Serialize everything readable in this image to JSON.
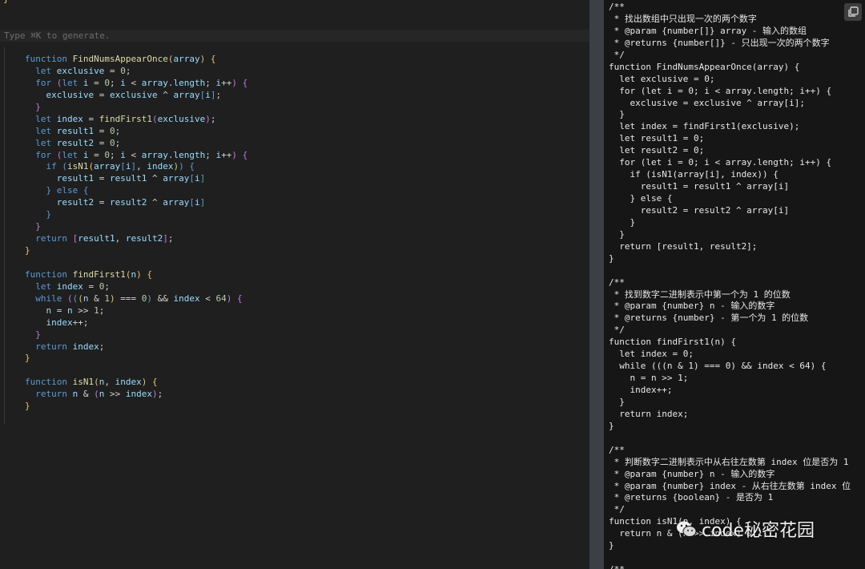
{
  "editor": {
    "stub_char": "}",
    "prompt_placeholder": "Type ⌘K to generate.",
    "code_lines": [
      [
        [
          "kw",
          "function "
        ],
        [
          "fn",
          "FindNumsAppearOnce"
        ],
        [
          "br",
          "("
        ],
        [
          "var",
          "array"
        ],
        [
          "br",
          ") {"
        ]
      ],
      [
        [
          "op",
          "  "
        ],
        [
          "kw",
          "let "
        ],
        [
          "var",
          "exclusive"
        ],
        [
          "op",
          " = "
        ],
        [
          "num",
          "0"
        ],
        [
          "op",
          ";"
        ]
      ],
      [
        [
          "op",
          "  "
        ],
        [
          "kw",
          "for "
        ],
        [
          "br2",
          "("
        ],
        [
          "kw",
          "let "
        ],
        [
          "var",
          "i"
        ],
        [
          "op",
          " = "
        ],
        [
          "num",
          "0"
        ],
        [
          "op",
          "; "
        ],
        [
          "var",
          "i"
        ],
        [
          "op",
          " < "
        ],
        [
          "var",
          "array"
        ],
        [
          "op",
          "."
        ],
        [
          "var",
          "length"
        ],
        [
          "op",
          "; "
        ],
        [
          "var",
          "i"
        ],
        [
          "op",
          "++"
        ],
        [
          "br2",
          ") {"
        ]
      ],
      [
        [
          "op",
          "    "
        ],
        [
          "var",
          "exclusive"
        ],
        [
          "op",
          " = "
        ],
        [
          "var",
          "exclusive"
        ],
        [
          "op",
          " ^ "
        ],
        [
          "var",
          "array"
        ],
        [
          "kw",
          "["
        ],
        [
          "var",
          "i"
        ],
        [
          "kw",
          "]"
        ],
        [
          "op",
          ";"
        ]
      ],
      [
        [
          "op",
          "  "
        ],
        [
          "br2",
          "}"
        ]
      ],
      [
        [
          "op",
          "  "
        ],
        [
          "kw",
          "let "
        ],
        [
          "var",
          "index"
        ],
        [
          "op",
          " = "
        ],
        [
          "fn",
          "findFirst1"
        ],
        [
          "br2",
          "("
        ],
        [
          "var",
          "exclusive"
        ],
        [
          "br2",
          ")"
        ],
        [
          "op",
          ";"
        ]
      ],
      [
        [
          "op",
          "  "
        ],
        [
          "kw",
          "let "
        ],
        [
          "var",
          "result1"
        ],
        [
          "op",
          " = "
        ],
        [
          "num",
          "0"
        ],
        [
          "op",
          ";"
        ]
      ],
      [
        [
          "op",
          "  "
        ],
        [
          "kw",
          "let "
        ],
        [
          "var",
          "result2"
        ],
        [
          "op",
          " = "
        ],
        [
          "num",
          "0"
        ],
        [
          "op",
          ";"
        ]
      ],
      [
        [
          "op",
          "  "
        ],
        [
          "kw",
          "for "
        ],
        [
          "br2",
          "("
        ],
        [
          "kw",
          "let "
        ],
        [
          "var",
          "i"
        ],
        [
          "op",
          " = "
        ],
        [
          "num",
          "0"
        ],
        [
          "op",
          "; "
        ],
        [
          "var",
          "i"
        ],
        [
          "op",
          " < "
        ],
        [
          "var",
          "array"
        ],
        [
          "op",
          "."
        ],
        [
          "var",
          "length"
        ],
        [
          "op",
          "; "
        ],
        [
          "var",
          "i"
        ],
        [
          "op",
          "++"
        ],
        [
          "br2",
          ") {"
        ]
      ],
      [
        [
          "op",
          "    "
        ],
        [
          "kw",
          "if "
        ],
        [
          "kw",
          "("
        ],
        [
          "fn",
          "isN1"
        ],
        [
          "br",
          "("
        ],
        [
          "var",
          "array"
        ],
        [
          "kw",
          "["
        ],
        [
          "var",
          "i"
        ],
        [
          "kw",
          "]"
        ],
        [
          "op",
          ", "
        ],
        [
          "var",
          "index"
        ],
        [
          "br",
          ")"
        ],
        [
          "kw",
          ") {"
        ]
      ],
      [
        [
          "op",
          "      "
        ],
        [
          "var",
          "result1"
        ],
        [
          "op",
          " = "
        ],
        [
          "var",
          "result1"
        ],
        [
          "op",
          " ^ "
        ],
        [
          "var",
          "array"
        ],
        [
          "kw",
          "["
        ],
        [
          "var",
          "i"
        ],
        [
          "kw",
          "]"
        ]
      ],
      [
        [
          "op",
          "    "
        ],
        [
          "kw",
          "} "
        ],
        [
          "kw",
          "else "
        ],
        [
          "kw",
          "{"
        ]
      ],
      [
        [
          "op",
          "      "
        ],
        [
          "var",
          "result2"
        ],
        [
          "op",
          " = "
        ],
        [
          "var",
          "result2"
        ],
        [
          "op",
          " ^ "
        ],
        [
          "var",
          "array"
        ],
        [
          "kw",
          "["
        ],
        [
          "var",
          "i"
        ],
        [
          "kw",
          "]"
        ]
      ],
      [
        [
          "op",
          "    "
        ],
        [
          "kw",
          "}"
        ]
      ],
      [
        [
          "op",
          "  "
        ],
        [
          "br2",
          "}"
        ]
      ],
      [
        [
          "op",
          "  "
        ],
        [
          "kw",
          "return "
        ],
        [
          "br2",
          "["
        ],
        [
          "var",
          "result1"
        ],
        [
          "op",
          ", "
        ],
        [
          "var",
          "result2"
        ],
        [
          "br2",
          "]"
        ],
        [
          "op",
          ";"
        ]
      ],
      [
        [
          "br",
          "}"
        ]
      ],
      [
        [
          "op",
          ""
        ]
      ],
      [
        [
          "kw",
          "function "
        ],
        [
          "fn",
          "findFirst1"
        ],
        [
          "br",
          "("
        ],
        [
          "var",
          "n"
        ],
        [
          "br",
          ") {"
        ]
      ],
      [
        [
          "op",
          "  "
        ],
        [
          "kw",
          "let "
        ],
        [
          "var",
          "index"
        ],
        [
          "op",
          " = "
        ],
        [
          "num",
          "0"
        ],
        [
          "op",
          ";"
        ]
      ],
      [
        [
          "op",
          "  "
        ],
        [
          "kw",
          "while "
        ],
        [
          "br2",
          "("
        ],
        [
          "kw",
          "("
        ],
        [
          "br",
          "("
        ],
        [
          "var",
          "n"
        ],
        [
          "op",
          " & "
        ],
        [
          "num",
          "1"
        ],
        [
          "br",
          ")"
        ],
        [
          "op",
          " === "
        ],
        [
          "num",
          "0"
        ],
        [
          "kw",
          ")"
        ],
        [
          "op",
          " && "
        ],
        [
          "var",
          "index"
        ],
        [
          "op",
          " < "
        ],
        [
          "num",
          "64"
        ],
        [
          "br2",
          ") {"
        ]
      ],
      [
        [
          "op",
          "    "
        ],
        [
          "var",
          "n"
        ],
        [
          "op",
          " = "
        ],
        [
          "var",
          "n"
        ],
        [
          "op",
          " >> "
        ],
        [
          "num",
          "1"
        ],
        [
          "op",
          ";"
        ]
      ],
      [
        [
          "op",
          "    "
        ],
        [
          "var",
          "index"
        ],
        [
          "op",
          "++;"
        ]
      ],
      [
        [
          "op",
          "  "
        ],
        [
          "br2",
          "}"
        ]
      ],
      [
        [
          "op",
          "  "
        ],
        [
          "kw",
          "return "
        ],
        [
          "var",
          "index"
        ],
        [
          "op",
          ";"
        ]
      ],
      [
        [
          "br",
          "}"
        ]
      ],
      [
        [
          "op",
          ""
        ]
      ],
      [
        [
          "kw",
          "function "
        ],
        [
          "fn",
          "isN1"
        ],
        [
          "br",
          "("
        ],
        [
          "var",
          "n"
        ],
        [
          "op",
          ", "
        ],
        [
          "var",
          "index"
        ],
        [
          "br",
          ") {"
        ]
      ],
      [
        [
          "op",
          "  "
        ],
        [
          "kw",
          "return "
        ],
        [
          "var",
          "n"
        ],
        [
          "op",
          " & "
        ],
        [
          "br2",
          "("
        ],
        [
          "var",
          "n"
        ],
        [
          "op",
          " >> "
        ],
        [
          "var",
          "index"
        ],
        [
          "br2",
          ")"
        ],
        [
          "op",
          ";"
        ]
      ],
      [
        [
          "br",
          "}"
        ]
      ]
    ]
  },
  "panel": {
    "lines": [
      "/**",
      " * 找出数组中只出现一次的两个数字",
      " * @param {number[]} array - 输入的数组",
      " * @returns {number[]} - 只出现一次的两个数字",
      " */",
      "function FindNumsAppearOnce(array) {",
      "  let exclusive = 0;",
      "  for (let i = 0; i < array.length; i++) {",
      "    exclusive = exclusive ^ array[i];",
      "  }",
      "  let index = findFirst1(exclusive);",
      "  let result1 = 0;",
      "  let result2 = 0;",
      "  for (let i = 0; i < array.length; i++) {",
      "    if (isN1(array[i], index)) {",
      "      result1 = result1 ^ array[i]",
      "    } else {",
      "      result2 = result2 ^ array[i]",
      "    }",
      "  }",
      "  return [result1, result2];",
      "}",
      "",
      "/**",
      " * 找到数字二进制表示中第一个为 1 的位数",
      " * @param {number} n - 输入的数字",
      " * @returns {number} - 第一个为 1 的位数",
      " */",
      "function findFirst1(n) {",
      "  let index = 0;",
      "  while (((n & 1) === 0) && index < 64) {",
      "    n = n >> 1;",
      "    index++;",
      "  }",
      "  return index;",
      "}",
      "",
      "/**",
      " * 判断数字二进制表示中从右往左数第 index 位是否为 1",
      " * @param {number} n - 输入的数字",
      " * @param {number} index - 从右往左数第 index 位",
      " * @returns {boolean} - 是否为 1",
      " */",
      "function isN1(n, index) {",
      "  return n & (n >> index) & 1;",
      "}",
      "",
      "/**"
    ]
  },
  "copy_button": {
    "icon": "copy-icon"
  },
  "watermark": {
    "text": "code秘密花园",
    "icon": "wechat-icon"
  }
}
